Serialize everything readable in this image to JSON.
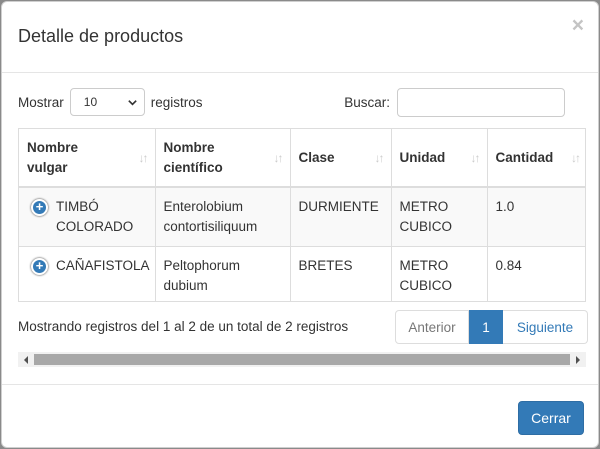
{
  "modal": {
    "title": "Detalle de productos",
    "close_symbol": "×",
    "close_button": "Cerrar"
  },
  "length": {
    "prefix": "Mostrar",
    "value": "10",
    "suffix": "registros"
  },
  "search": {
    "label": "Buscar:",
    "value": ""
  },
  "table": {
    "columns": [
      {
        "label": "Nombre vulgar"
      },
      {
        "label": "Nombre científico"
      },
      {
        "label": "Clase"
      },
      {
        "label": "Unidad"
      },
      {
        "label": "Cantidad"
      }
    ],
    "rows": [
      [
        "TIMBÓ COLORADO",
        "Enterolobium contortisiliquum",
        "DURMIENTE",
        "METRO CUBICO",
        "1.0"
      ],
      [
        "CAÑAFISTOLA",
        "Peltophorum dubium",
        "BRETES",
        "METRO CUBICO",
        "0.84"
      ]
    ],
    "sort_symbol": "↓↑"
  },
  "info": "Mostrando registros del 1 al 2 de un total de 2 registros",
  "pagination": {
    "previous": "Anterior",
    "current": "1",
    "next": "Siguiente"
  },
  "icons": {
    "expand": "plus-circle-icon",
    "select_arrow": "chevron-down-icon",
    "scroll_left": "scroll-left-arrow-icon",
    "scroll_right": "scroll-right-arrow-icon"
  },
  "colors": {
    "primary": "#337ab7",
    "backdrop": "#8a8a8a"
  }
}
